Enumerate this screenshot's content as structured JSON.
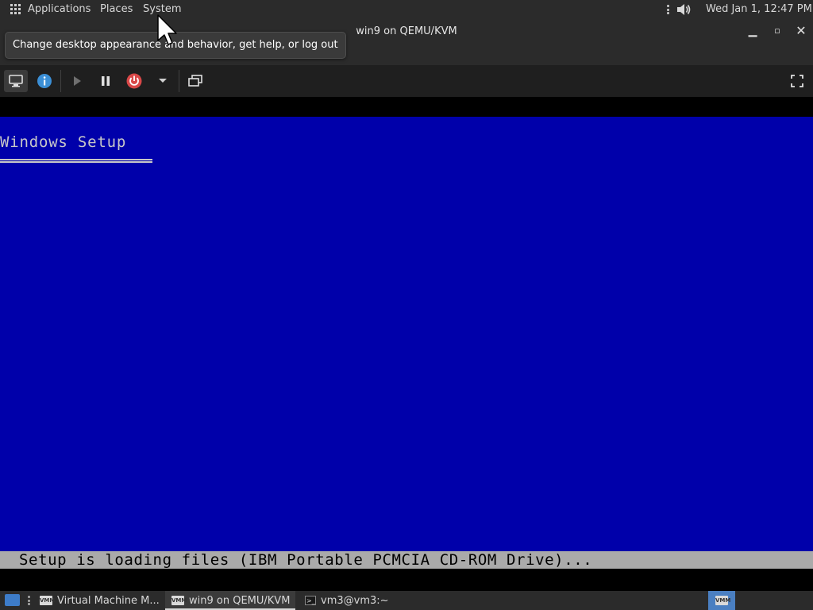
{
  "top_panel": {
    "menu": [
      "Applications",
      "Places",
      "System"
    ],
    "clock": "Wed Jan 1, 12:47 PM",
    "icons": [
      "apps-grid-icon",
      "tray-handle-icon",
      "volume-icon"
    ]
  },
  "window": {
    "title": "win9 on QEMU/KVM",
    "controls": [
      "minimize",
      "maximize",
      "close"
    ],
    "tooltip": "Change desktop appearance and behavior, get help, or log out"
  },
  "toolbar": {
    "buttons": [
      "console-icon",
      "details-icon",
      "run-icon",
      "pause-icon",
      "shutdown-icon",
      "shutdown-menu-icon",
      "snapshots-icon",
      "fullscreen-icon"
    ]
  },
  "guest": {
    "setup_title": "Windows Setup",
    "status_line": "Setup is loading files (IBM Portable PCMCIA CD-ROM Drive)...",
    "colors": {
      "screen": "#0000aa",
      "text": "#c8c8c8",
      "status_bar": "#aaaaaa"
    }
  },
  "taskbar": {
    "tasks": [
      {
        "label": "Virtual Machine M...",
        "icon": "vmm-icon",
        "active": false
      },
      {
        "label": "win9 on QEMU/KVM",
        "icon": "vmm-icon",
        "active": true
      },
      {
        "label": "vm3@vm3:~",
        "icon": "terminal-icon",
        "active": false
      }
    ]
  }
}
